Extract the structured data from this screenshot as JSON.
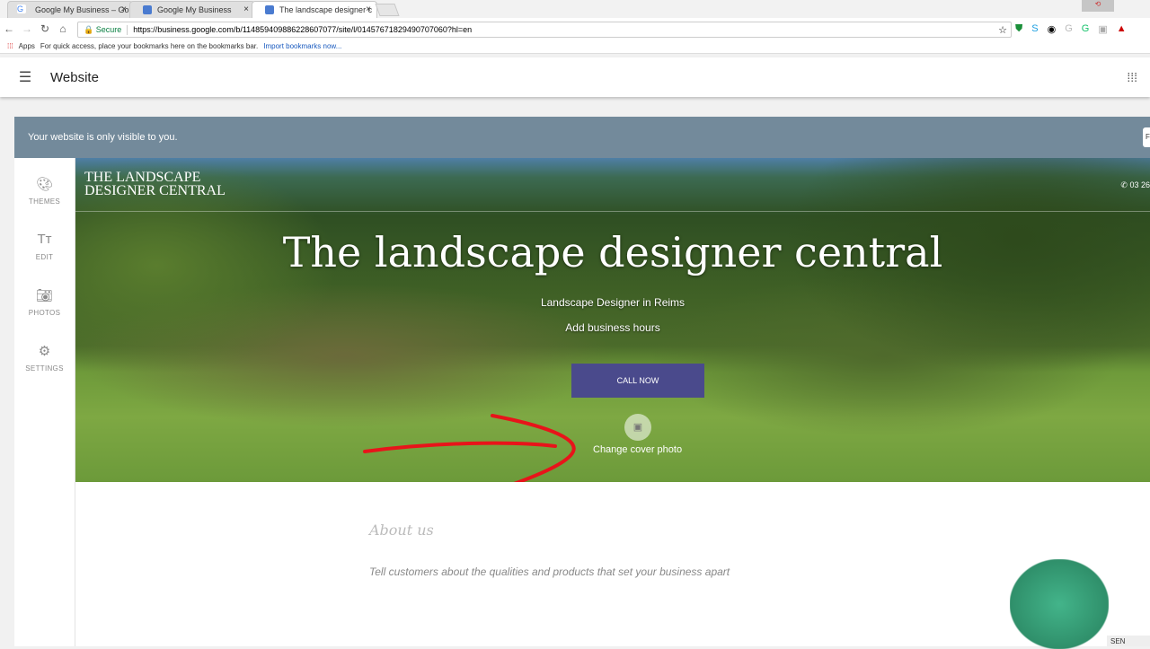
{
  "browser": {
    "tabs": [
      "Google My Business – Go",
      "Google My Business",
      "The landscape designer c"
    ],
    "url": "https://business.google.com/b/114859409886228607077/site/l/01457671829490707060?hl=en",
    "secure_label": "Secure",
    "apps_label": "Apps",
    "bookmarks_hint": "For quick access, place your bookmarks here on the bookmarks bar.",
    "import_link": "Import bookmarks now..."
  },
  "appbar": {
    "title": "Website"
  },
  "banner": {
    "text": "Your website is only visible to you.",
    "button": "F"
  },
  "sidebar": [
    {
      "icon": "palette-icon",
      "label": "THEMES"
    },
    {
      "icon": "text-icon",
      "label": "EDIT"
    },
    {
      "icon": "camera-icon",
      "label": "PHOTOS"
    },
    {
      "icon": "gear-icon",
      "label": "SETTINGS"
    }
  ],
  "hero": {
    "brand": "THE LANDSCAPE DESIGNER CENTRAL",
    "phone": "03 26",
    "title": "The landscape designer central",
    "subtitle": "Landscape Designer in Reims",
    "hours": "Add business hours",
    "cta": "CALL NOW",
    "change_photo": "Change cover photo"
  },
  "about": {
    "heading": "About us",
    "description": "Tell customers about the qualities and products that set your business apart"
  },
  "footer": {
    "send": "SEN"
  },
  "colors": {
    "banner": "#738a9b",
    "cta": "#4a4a8c",
    "annotation": "#e8141a"
  }
}
